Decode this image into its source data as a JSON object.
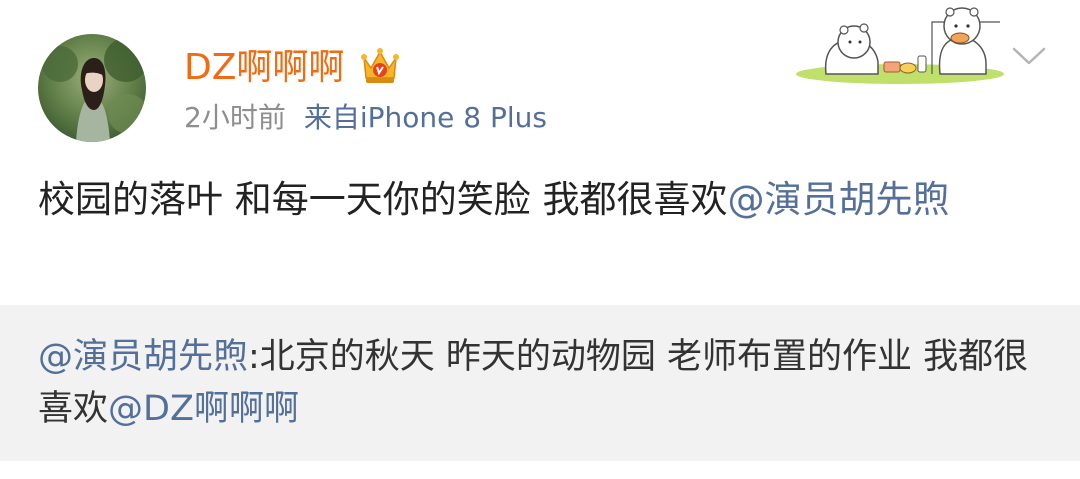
{
  "post": {
    "username": "DZ啊啊啊",
    "time": "2小时前",
    "source": "来自iPhone 8 Plus",
    "text": "校园的落叶 和每一天你的笑脸 我都很喜欢",
    "mention": "@演员胡先煦"
  },
  "repost": {
    "author": "@演员胡先煦",
    "text": ":北京的秋天 昨天的动物园 老师布置的作业 我都很喜欢",
    "mention": "@DZ啊啊啊"
  },
  "icons": {
    "vip": "crown-badge-icon",
    "expand": "chevron-down-icon",
    "sticker": "bear-picnic-sticker"
  },
  "colors": {
    "username": "#f26a12",
    "link": "#536f9a",
    "meta": "#8e8e8e",
    "repost_bg": "#f2f2f2"
  }
}
